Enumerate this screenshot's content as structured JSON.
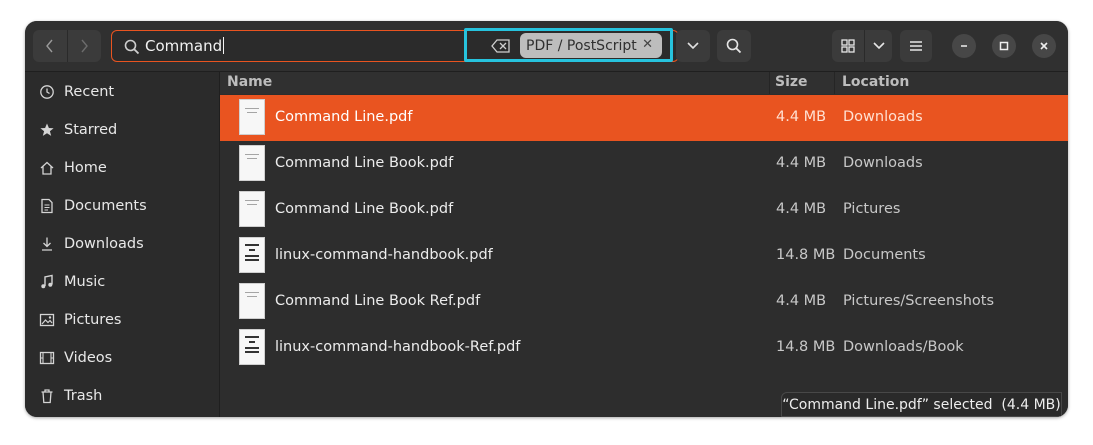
{
  "search": {
    "query": "Command",
    "filter_chip": "PDF / PostScript"
  },
  "sidebar": {
    "items": [
      {
        "label": "Recent"
      },
      {
        "label": "Starred"
      },
      {
        "label": "Home"
      },
      {
        "label": "Documents"
      },
      {
        "label": "Downloads"
      },
      {
        "label": "Music"
      },
      {
        "label": "Pictures"
      },
      {
        "label": "Videos"
      },
      {
        "label": "Trash"
      }
    ]
  },
  "columns": {
    "name": "Name",
    "size": "Size",
    "location": "Location"
  },
  "files": [
    {
      "name": "Command Line.pdf",
      "size": "4.4 MB",
      "location": "Downloads"
    },
    {
      "name": "Command Line Book.pdf",
      "size": "4.4 MB",
      "location": "Downloads"
    },
    {
      "name": "Command Line Book.pdf",
      "size": "4.4 MB",
      "location": "Pictures"
    },
    {
      "name": "linux-command-handbook.pdf",
      "size": "14.8 MB",
      "location": "Documents"
    },
    {
      "name": "Command Line Book Ref.pdf",
      "size": "4.4 MB",
      "location": "Pictures/Screenshots"
    },
    {
      "name": "linux-command-handbook-Ref.pdf",
      "size": "14.8 MB",
      "location": "Downloads/Book"
    }
  ],
  "status": "“Command Line.pdf” selected  (4.4 MB)",
  "colors": {
    "accent": "#e95420",
    "highlight": "#27c3dd",
    "window_bg": "#2d2d2d",
    "sidebar_bg": "#2b2b2b"
  },
  "icons": {
    "nav": [
      "back-arrow-icon",
      "forward-arrow-icon"
    ],
    "search": "search-icon",
    "clear": "backspace-icon",
    "sidebar": [
      "clock-icon",
      "star-icon",
      "home-icon",
      "document-icon",
      "download-icon",
      "music-icon",
      "picture-icon",
      "video-icon",
      "trash-icon"
    ],
    "window": [
      "minimize-icon",
      "maximize-icon",
      "close-icon"
    ]
  }
}
